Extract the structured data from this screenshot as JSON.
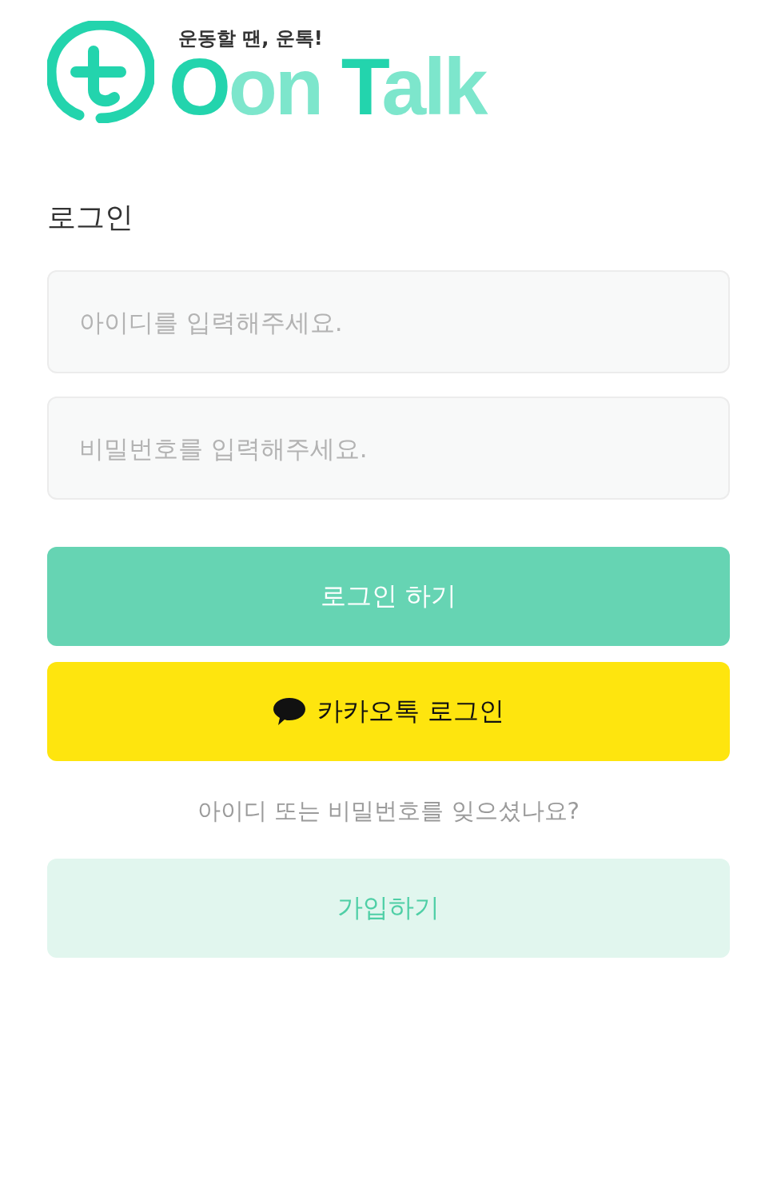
{
  "logo": {
    "tagline": "운동할 땐, 운톡!",
    "wordmark": [
      {
        "text": "O",
        "color": "#23d4ad"
      },
      {
        "text": "on ",
        "color": "#7de6cc"
      },
      {
        "text": "T",
        "color": "#23d4ad"
      },
      {
        "text": "alk",
        "color": "#7de6cc"
      }
    ]
  },
  "title": "로그인",
  "fields": [
    {
      "placeholder": "아이디를 입력해주세요."
    },
    {
      "placeholder": "비밀번호를 입력해주세요."
    }
  ],
  "buttons": [
    {
      "label": "로그인 하기",
      "kind": "primary"
    },
    {
      "label": "카카오톡 로그인",
      "kind": "kakao"
    }
  ],
  "forgot_link": "아이디 또는 비밀번호를 잊으셨나요?",
  "signup_button": "가입하기"
}
